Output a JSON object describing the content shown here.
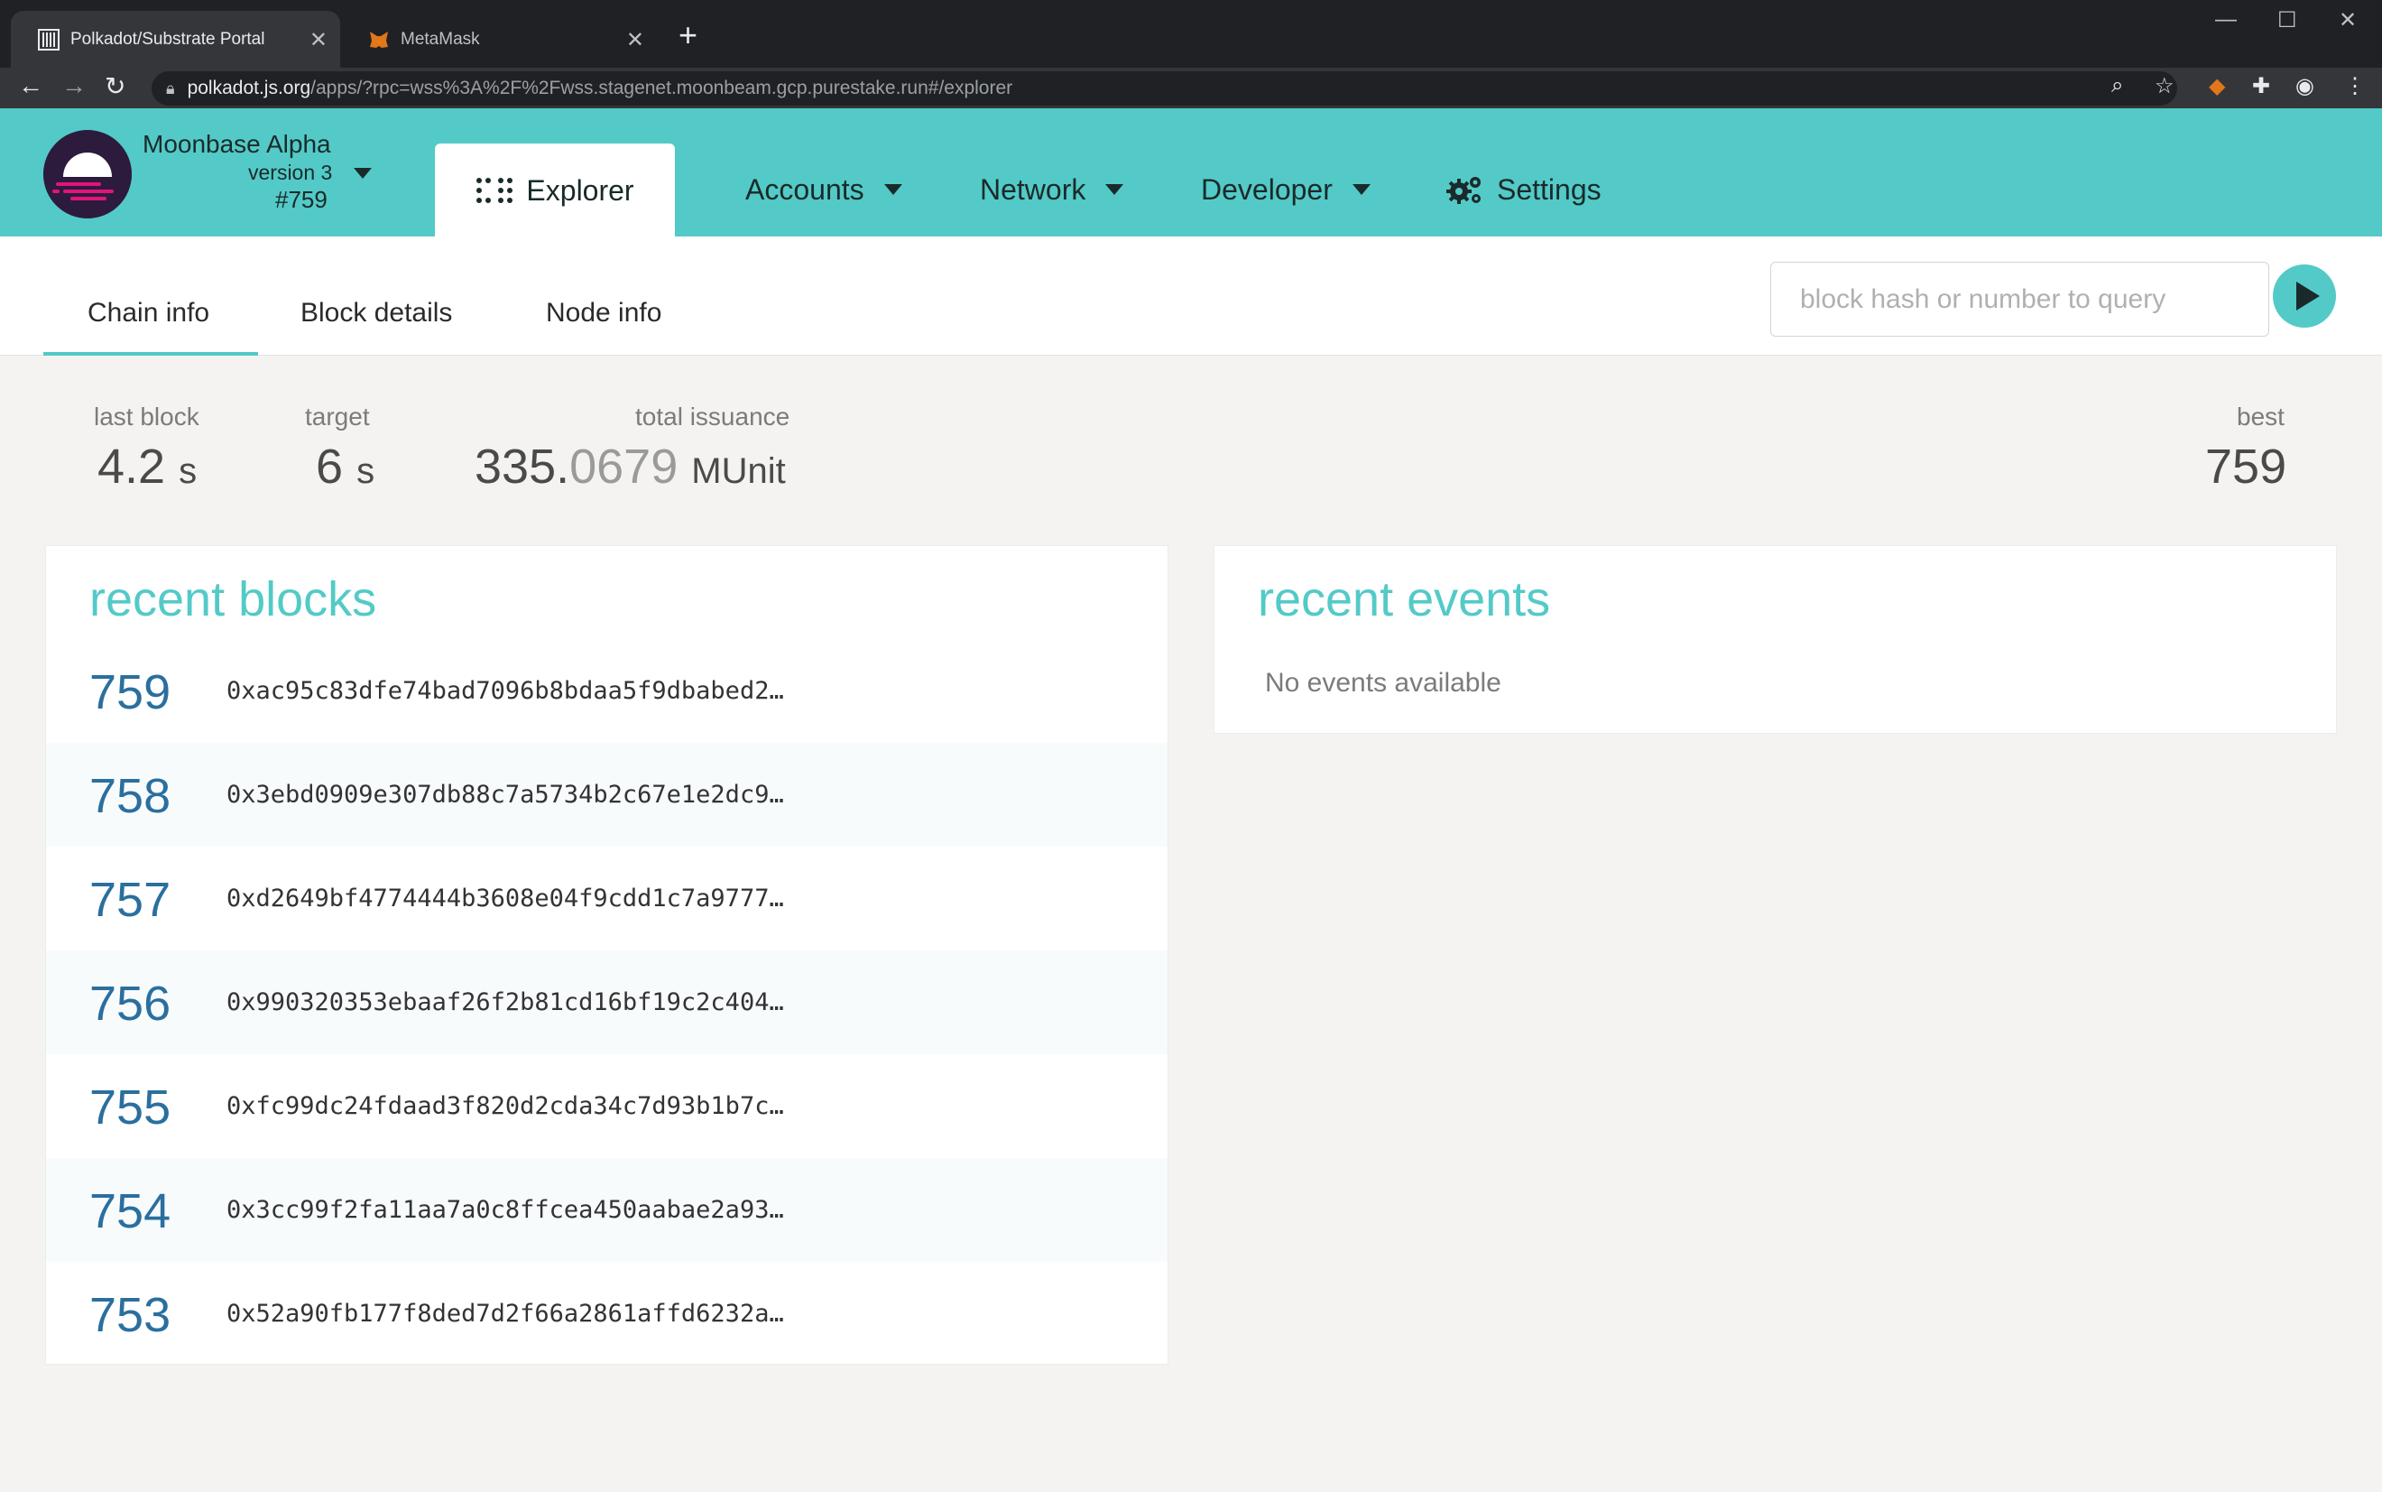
{
  "browser": {
    "tabs": [
      {
        "title": "Polkadot/Substrate Portal",
        "active": true
      },
      {
        "title": "MetaMask",
        "active": false
      }
    ],
    "url_host": "polkadot.js.org",
    "url_path": "/apps/?rpc=wss%3A%2F%2Fwss.stagenet.moonbeam.gcp.purestake.run#/explorer"
  },
  "chain": {
    "name": "Moonbase Alpha",
    "version": "version 3",
    "block": "#759"
  },
  "menu": {
    "explorer": "Explorer",
    "accounts": "Accounts",
    "network": "Network",
    "developer": "Developer",
    "settings": "Settings"
  },
  "subnav": {
    "chain_info": "Chain info",
    "block_details": "Block details",
    "node_info": "Node info",
    "query_placeholder": "block hash or number to query"
  },
  "summary": {
    "last_block_label": "last block",
    "last_block_value": "4.2",
    "last_block_unit": "s",
    "target_label": "target",
    "target_value": "6",
    "target_unit": "s",
    "issuance_label": "total issuance",
    "issuance_int": "335.",
    "issuance_dec": "0679",
    "issuance_unit": "MUnit",
    "best_label": "best",
    "best_value": "759"
  },
  "recent_blocks": {
    "title": "recent blocks",
    "rows": [
      {
        "number": "759",
        "hash": "0xac95c83dfe74bad7096b8bdaa5f9dbabed2…"
      },
      {
        "number": "758",
        "hash": "0x3ebd0909e307db88c7a5734b2c67e1e2dc9…"
      },
      {
        "number": "757",
        "hash": "0xd2649bf4774444b3608e04f9cdd1c7a9777…"
      },
      {
        "number": "756",
        "hash": "0x990320353ebaaf26f2b81cd16bf19c2c404…"
      },
      {
        "number": "755",
        "hash": "0xfc99dc24fdaad3f820d2cda34c7d93b1b7c…"
      },
      {
        "number": "754",
        "hash": "0x3cc99f2fa11aa7a0c8ffcea450aabae2a93…"
      },
      {
        "number": "753",
        "hash": "0x52a90fb177f8ded7d2f66a2861affd6232a…"
      }
    ]
  },
  "recent_events": {
    "title": "recent events",
    "empty": "No events available"
  },
  "colors": {
    "accent": "#53cac7",
    "block_number": "#2a6f9e",
    "chrome_dark": "#202124"
  }
}
